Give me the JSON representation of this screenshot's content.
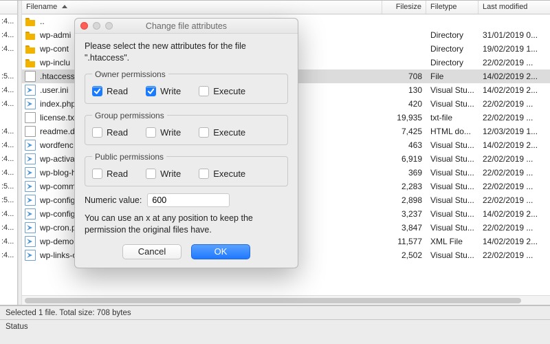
{
  "columns": {
    "name": "Filename",
    "size": "Filesize",
    "type": "Filetype",
    "mod": "Last modified"
  },
  "left_times": [
    ":4...",
    ":4...",
    ":4...",
    "",
    ":5...",
    ":4...",
    ":4...",
    "",
    ":4...",
    ":4...",
    ":4...",
    ":4...",
    ":5...",
    ":5...",
    ":4...",
    ":4...",
    ":4...",
    ":4..."
  ],
  "files": [
    {
      "icon": "folder",
      "name": "..",
      "size": "",
      "type": "",
      "mod": ""
    },
    {
      "icon": "folder",
      "name": "wp-admi",
      "size": "",
      "type": "Directory",
      "mod": "31/01/2019 0..."
    },
    {
      "icon": "folder",
      "name": "wp-cont",
      "size": "",
      "type": "Directory",
      "mod": "19/02/2019 1..."
    },
    {
      "icon": "folder",
      "name": "wp-inclu",
      "size": "",
      "type": "Directory",
      "mod": "22/02/2019 ..."
    },
    {
      "icon": "file-plain",
      "name": ".htaccess",
      "size": "708",
      "type": "File",
      "mod": "14/02/2019 2...",
      "selected": true
    },
    {
      "icon": "file-vs",
      "name": ".user.ini",
      "size": "130",
      "type": "Visual Stu...",
      "mod": "14/02/2019 2..."
    },
    {
      "icon": "file-vs",
      "name": "index.php",
      "size": "420",
      "type": "Visual Stu...",
      "mod": "22/02/2019 ..."
    },
    {
      "icon": "file-plain",
      "name": "license.tx",
      "size": "19,935",
      "type": "txt-file",
      "mod": "22/02/2019 ..."
    },
    {
      "icon": "file-plain",
      "name": "readme.d6",
      "size": "7,425",
      "type": "HTML do...",
      "mod": "12/03/2019 1..."
    },
    {
      "icon": "file-vs",
      "name": "wordfenc",
      "size": "463",
      "type": "Visual Stu...",
      "mod": "14/02/2019 2..."
    },
    {
      "icon": "file-vs",
      "name": "wp-activa",
      "size": "6,919",
      "type": "Visual Stu...",
      "mod": "22/02/2019 ..."
    },
    {
      "icon": "file-vs",
      "name": "wp-blog-h",
      "size": "369",
      "type": "Visual Stu...",
      "mod": "22/02/2019 ..."
    },
    {
      "icon": "file-vs",
      "name": "wp-comm",
      "size": "2,283",
      "type": "Visual Stu...",
      "mod": "22/02/2019 ..."
    },
    {
      "icon": "file-vs",
      "name": "wp-config",
      "size": "2,898",
      "type": "Visual Stu...",
      "mod": "22/02/2019 ..."
    },
    {
      "icon": "file-vs",
      "name": "wp-config",
      "size": "3,237",
      "type": "Visual Stu...",
      "mod": "14/02/2019 2..."
    },
    {
      "icon": "file-vs",
      "name": "wp-cron.p",
      "size": "3,847",
      "type": "Visual Stu...",
      "mod": "22/02/2019 ..."
    },
    {
      "icon": "file-vs",
      "name": "wp-demo.",
      "size": "11,577",
      "type": "XML File",
      "mod": "14/02/2019 2..."
    },
    {
      "icon": "file-vs",
      "name": "wp-links-o",
      "size": "2,502",
      "type": "Visual Stu...",
      "mod": "22/02/2019 ..."
    }
  ],
  "status1": "Selected 1 file. Total size: 708 bytes",
  "status2": "Status",
  "dialog": {
    "title": "Change file attributes",
    "intro": "Please select the new attributes for the file \".htaccess\".",
    "groups": {
      "owner": {
        "label": "Owner permissions",
        "read": true,
        "write": true,
        "exec": false
      },
      "group": {
        "label": "Group permissions",
        "read": false,
        "write": false,
        "exec": false
      },
      "public": {
        "label": "Public permissions",
        "read": false,
        "write": false,
        "exec": false
      }
    },
    "perm_labels": {
      "read": "Read",
      "write": "Write",
      "exec": "Execute"
    },
    "numeric_label": "Numeric value:",
    "numeric_value": "600",
    "hint": "You can use an x at any position to keep the permission the original files have.",
    "cancel": "Cancel",
    "ok": "OK"
  }
}
